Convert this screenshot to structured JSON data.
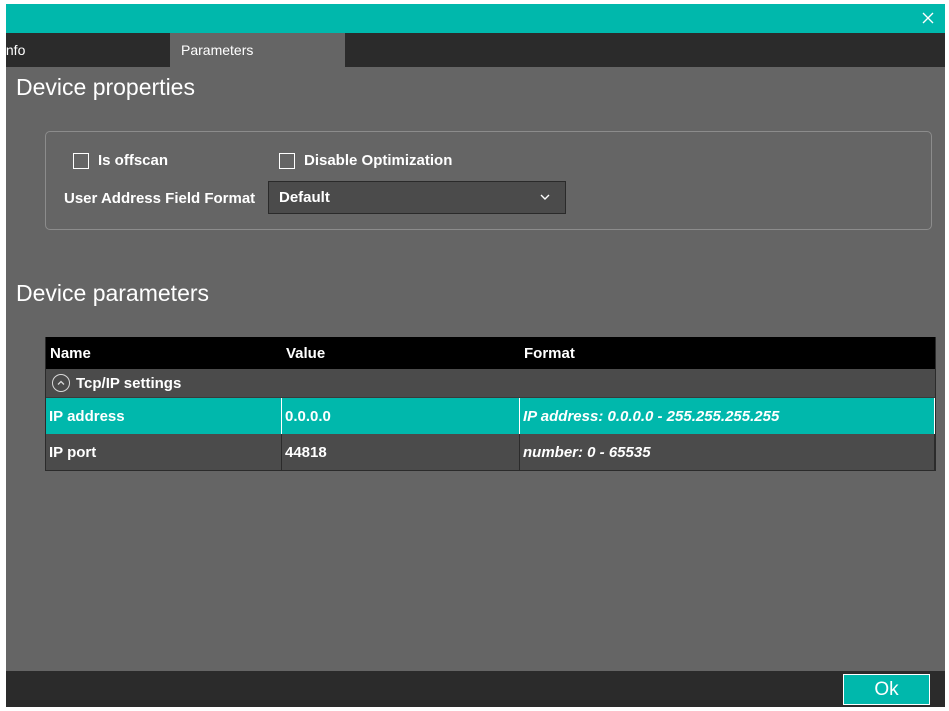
{
  "colors": {
    "accent": "#00b8ac",
    "background": "#656565",
    "dark": "#2b2b2b",
    "table_header": "#000000"
  },
  "tabs": [
    {
      "label": "Info"
    },
    {
      "label": "Parameters"
    }
  ],
  "device_properties": {
    "title": "Device properties",
    "is_offscan_label": "Is offscan",
    "disable_optimization_label": "Disable Optimization",
    "address_format_label": "User Address Field Format",
    "address_format_value": "Default"
  },
  "device_parameters": {
    "title": "Device parameters",
    "columns": {
      "name": "Name",
      "value": "Value",
      "format": "Format"
    },
    "group_label": "Tcp/IP settings",
    "rows": [
      {
        "name": "IP address",
        "value": "0.0.0.0",
        "format": "IP address: 0.0.0.0 - 255.255.255.255"
      },
      {
        "name": "IP port",
        "value": "44818",
        "format": "number: 0 - 65535"
      }
    ]
  },
  "footer": {
    "ok_label": "Ok"
  },
  "icons": {
    "close": "close-icon",
    "dropdown": "chevron-down-icon",
    "group_toggle": "chevron-up-circle-icon"
  }
}
